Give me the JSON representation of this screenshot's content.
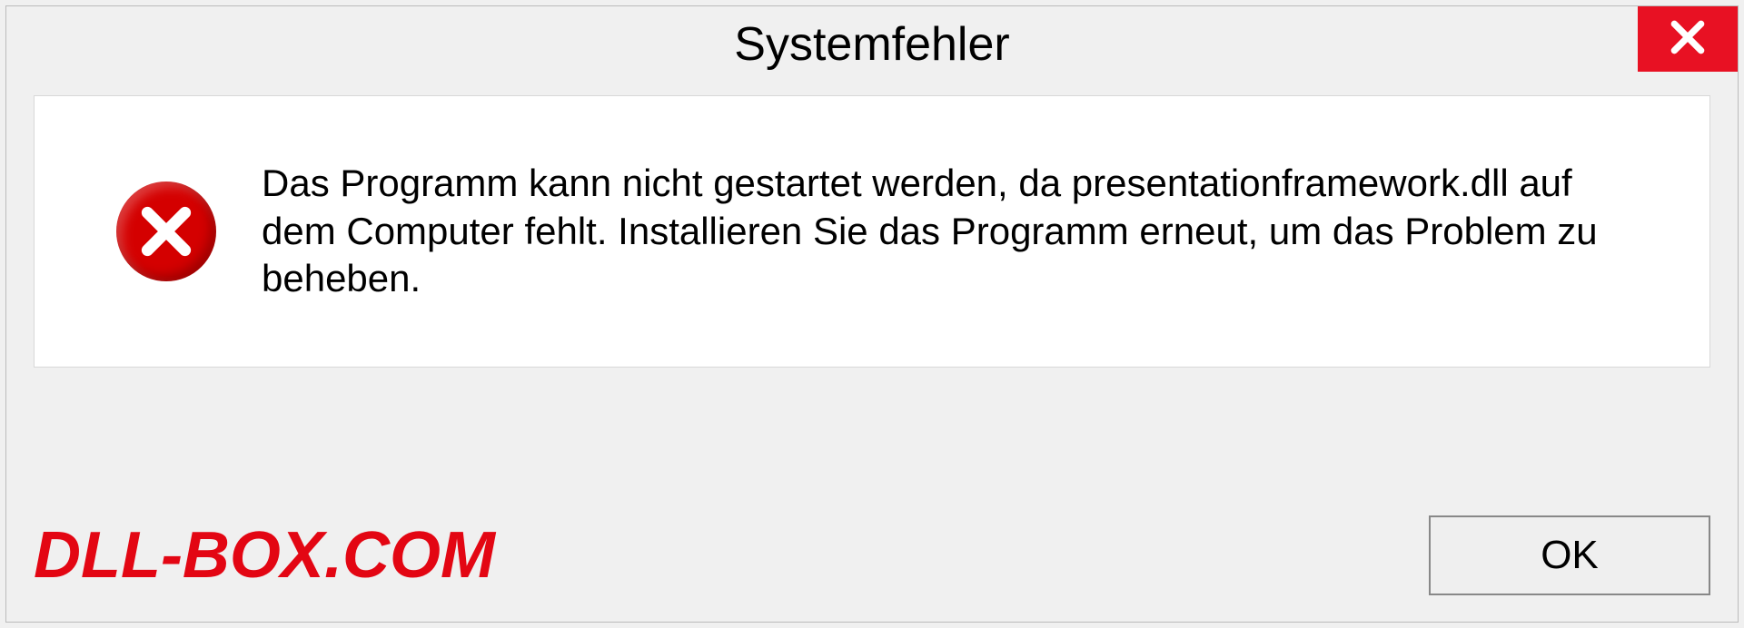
{
  "dialog": {
    "title": "Systemfehler",
    "message": "Das Programm kann nicht gestartet werden, da presentationframework.dll auf dem Computer fehlt. Installieren Sie das Programm erneut, um das Problem zu beheben.",
    "ok_label": "OK"
  },
  "watermark": "DLL-BOX.COM"
}
